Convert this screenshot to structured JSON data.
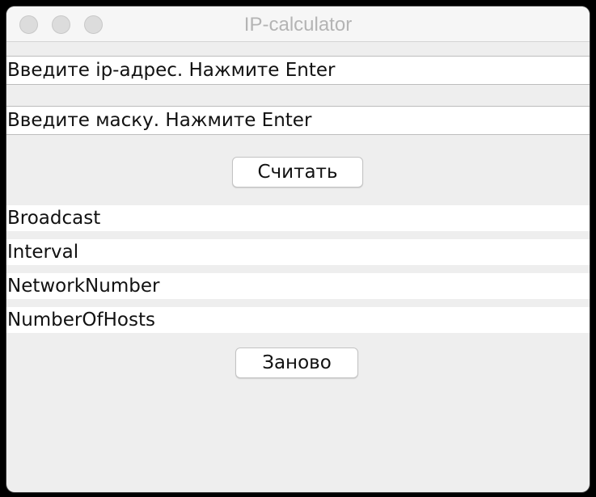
{
  "window": {
    "title": "IP-calculator"
  },
  "form": {
    "ip_field_value": "Введите ip-адрес. Нажмите Enter",
    "mask_field_value": "Введите маску. Нажмите Enter",
    "calculate_label": "Считать",
    "reset_label": "Заново"
  },
  "results": [
    {
      "label": "Broadcast"
    },
    {
      "label": "Interval"
    },
    {
      "label": "NetworkNumber"
    },
    {
      "label": "NumberOfHosts"
    }
  ]
}
